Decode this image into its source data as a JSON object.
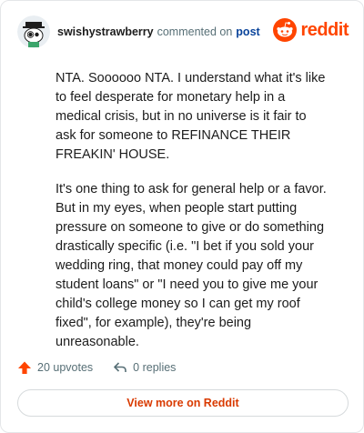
{
  "header": {
    "username": "swishystrawberry",
    "action_text": "commented on",
    "post_link": "post",
    "avatar_icon": "snoo-avatar-icon",
    "brand_icon": "reddit-snoo-icon",
    "brand_wordmark": "reddit"
  },
  "comment": {
    "paragraphs": [
      "NTA. Soooooo NTA. I understand what it's like to feel desperate for monetary help in a medical crisis, but in no universe is it fair to ask for someone to REFINANCE THEIR FREAKIN' HOUSE.",
      "It's one thing to ask for general help or a favor. But in my eyes, when people start putting pressure on someone to give or do something drastically specific (i.e. \"I bet if you sold your wedding ring, that money could pay off my student loans\" or \"I need you to give me your child's college money so I can get my roof fixed\", for example), they're being unreasonable."
    ]
  },
  "stats": {
    "upvotes": "20 upvotes",
    "replies": "0 replies",
    "upvote_icon": "upvote-arrow-icon",
    "reply_icon": "reply-arrow-icon"
  },
  "footer": {
    "view_more_label": "View more on Reddit"
  },
  "colors": {
    "brand": "#ff4500",
    "link": "#0a449b",
    "muted": "#576f76",
    "cta": "#d93a00"
  }
}
